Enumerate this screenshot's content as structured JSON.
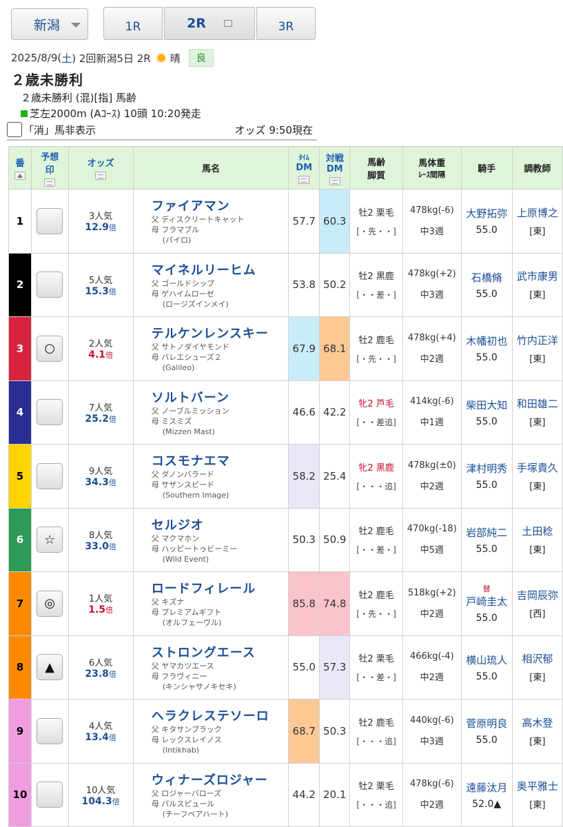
{
  "nav": {
    "venue": "新潟",
    "prev": "1R",
    "current": "2R",
    "next": "3R"
  },
  "header": {
    "date": "2025/8/9(",
    "dow": "土",
    "date_tail": ") 2回新潟5日 2R",
    "weather": "晴",
    "track": "良",
    "title": "２歳未勝利",
    "conditions": "２歳未勝利 (混)[指] 馬齢",
    "course": "芝左2000m (Aｺｰｽ) 10頭 10:20発走",
    "hide_label": "「消」馬非表示",
    "odds_time": "オッズ 9:50現在"
  },
  "columns": {
    "num": "番",
    "mark": [
      "予想",
      "印"
    ],
    "odds": "オッズ",
    "name": "馬名",
    "time_dm": [
      "ﾀｲﾑ",
      "DM"
    ],
    "vs_dm": [
      "対戦",
      "DM"
    ],
    "age": [
      "馬齢",
      "脚質"
    ],
    "weight": [
      "馬体重",
      "ﾚｰｽ間隔"
    ],
    "jockey": "騎手",
    "trainer": "調教師"
  },
  "colors": {
    "gate1": "#ffffff",
    "gate2": "#000000",
    "gate3": "#d7233e",
    "gate4": "#2a2d93",
    "gate5": "#ffd400",
    "gate6": "#2e9a57",
    "gate7": "#ff8a00",
    "gate8": "#ff8a00",
    "gate9": "#f09ce0",
    "gate10": "#f09ce0",
    "cell_blue": "#c9ecfb",
    "cell_orange": "#fcc994",
    "cell_pink": "#fbc3cc",
    "cell_lavender": "#e8e8f8",
    "odds_blue": "#1a4f95",
    "odds_red": "#c8102e"
  },
  "horses": [
    {
      "num": "1",
      "mark": "",
      "pop": "3人気",
      "odds": "12.9",
      "name": "ファイアマン",
      "sire": "父 ディスクリートキャット",
      "dam": "母 フラマブル",
      "bms": "(パイロ)",
      "tdm": "57.7",
      "vdm": "60.3",
      "sex": "牡2 栗毛",
      "style": "[・先・・]",
      "weight": "478kg(-6)",
      "interval": "中3週",
      "jockey": "大野拓弥",
      "jsub": "",
      "jweight": "55.0",
      "trainer": "上原博之",
      "loc": "[東]"
    },
    {
      "num": "2",
      "mark": "",
      "pop": "5人気",
      "odds": "15.3",
      "name": "マイネルリーヒム",
      "sire": "父 ゴールドシップ",
      "dam": "母 ゲハイムローゼ",
      "bms": "(ロージズインメイ)",
      "tdm": "53.8",
      "vdm": "50.2",
      "sex": "牡2 黒鹿",
      "style": "[・・差・]",
      "weight": "478kg(+2)",
      "interval": "中3週",
      "jockey": "石橋脩",
      "jsub": "",
      "jweight": "55.0",
      "trainer": "武市康男",
      "loc": "[東]"
    },
    {
      "num": "3",
      "mark": "○",
      "pop": "2人気",
      "odds": "4.1",
      "name": "テルケンレンスキー",
      "sire": "父 サトノダイヤモンド",
      "dam": "母 バレエシューズ２",
      "bms": "(Galileo)",
      "tdm": "67.9",
      "vdm": "68.1",
      "sex": "牡2 鹿毛",
      "style": "[・先・・]",
      "weight": "478kg(+4)",
      "interval": "中2週",
      "jockey": "木幡初也",
      "jsub": "",
      "jweight": "55.0",
      "trainer": "竹内正洋",
      "loc": "[東]"
    },
    {
      "num": "4",
      "mark": "",
      "pop": "7人気",
      "odds": "25.2",
      "name": "ソルトバーン",
      "sire": "父 ノーブルミッション",
      "dam": "母 ミスミズ",
      "bms": "(Mizzen Mast)",
      "tdm": "46.6",
      "vdm": "42.2",
      "sex": "牝2 芦毛",
      "style": "[・・差追]",
      "weight": "414kg(-6)",
      "interval": "中1週",
      "jockey": "柴田大知",
      "jsub": "",
      "jweight": "55.0",
      "trainer": "和田雄二",
      "loc": "[東]"
    },
    {
      "num": "5",
      "mark": "",
      "pop": "9人気",
      "odds": "34.3",
      "name": "コスモナエマ",
      "sire": "父 ダノンバラード",
      "dam": "母 サザンスピード",
      "bms": "(Southern Image)",
      "tdm": "58.2",
      "vdm": "25.4",
      "sex": "牝2 黒鹿",
      "style": "[・・・追]",
      "weight": "478kg(±0)",
      "interval": "中2週",
      "jockey": "津村明秀",
      "jsub": "",
      "jweight": "55.0",
      "trainer": "手塚貴久",
      "loc": "[東]"
    },
    {
      "num": "6",
      "mark": "☆",
      "pop": "8人気",
      "odds": "33.0",
      "name": "セルジオ",
      "sire": "父 マクマホン",
      "dam": "母 ハッピートゥビーミー",
      "bms": "(Wild Event)",
      "tdm": "50.3",
      "vdm": "50.9",
      "sex": "牡2 鹿毛",
      "style": "[・・差・]",
      "weight": "470kg(-18)",
      "interval": "中5週",
      "jockey": "岩部純二",
      "jsub": "",
      "jweight": "55.0",
      "trainer": "土田稔",
      "loc": "[東]"
    },
    {
      "num": "7",
      "mark": "◎",
      "pop": "1人気",
      "odds": "1.5",
      "name": "ロードフィレール",
      "sire": "父 キズナ",
      "dam": "母 プレミアムギフト",
      "bms": "(オルフェーヴル)",
      "tdm": "85.8",
      "vdm": "74.8",
      "sex": "牡2 鹿毛",
      "style": "[・先・・]",
      "weight": "518kg(+2)",
      "interval": "中2週",
      "jockey": "戸崎圭太",
      "jsub": "替",
      "jweight": "55.0",
      "trainer": "吉岡辰弥",
      "loc": "[西]"
    },
    {
      "num": "8",
      "mark": "▲",
      "pop": "6人気",
      "odds": "23.8",
      "name": "ストロングエース",
      "sire": "父 ヤマカツエース",
      "dam": "母 フラヴィニー",
      "bms": "(キンシャサノキセキ)",
      "tdm": "55.0",
      "vdm": "57.3",
      "sex": "牡2 栗毛",
      "style": "[・・差・]",
      "weight": "466kg(-4)",
      "interval": "中2週",
      "jockey": "横山琉人",
      "jsub": "",
      "jweight": "55.0",
      "trainer": "相沢郁",
      "loc": "[東]"
    },
    {
      "num": "9",
      "mark": "",
      "pop": "4人気",
      "odds": "13.4",
      "name": "ヘラクレステソーロ",
      "sire": "父 キタサンブラック",
      "dam": "母 レックスレイノス",
      "bms": "(Intikhab)",
      "tdm": "68.7",
      "vdm": "50.3",
      "sex": "牡2 鹿毛",
      "style": "[・・・追]",
      "weight": "440kg(-6)",
      "interval": "中3週",
      "jockey": "菅原明良",
      "jsub": "",
      "jweight": "55.0",
      "trainer": "高木登",
      "loc": "[東]"
    },
    {
      "num": "10",
      "mark": "",
      "pop": "10人気",
      "odds": "104.3",
      "name": "ウィナーズロジャー",
      "sire": "父 ロジャーバローズ",
      "dam": "母 パルスピュール",
      "bms": "(チーフベアハート)",
      "tdm": "44.2",
      "vdm": "20.1",
      "sex": "牡2 栗毛",
      "style": "[・・・追]",
      "weight": "478kg(-6)",
      "interval": "中2週",
      "jockey": "遠藤汰月",
      "jsub": "",
      "jweight": "52.0▲",
      "trainer": "奥平雅士",
      "loc": "[東]"
    }
  ],
  "odds_unit": "倍"
}
